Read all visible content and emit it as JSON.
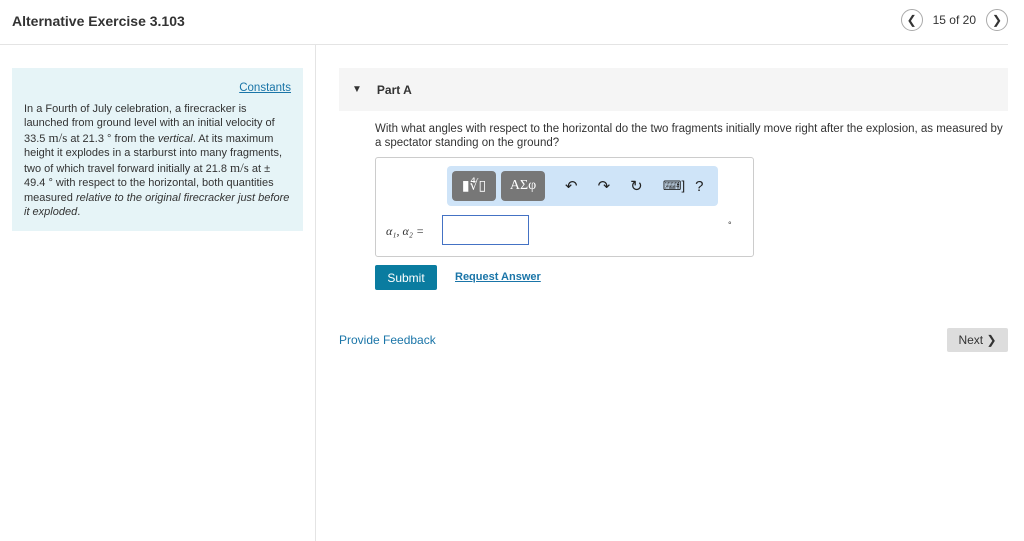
{
  "header": {
    "title": "Alternative Exercise 3.103",
    "position": "15 of 20"
  },
  "problem": {
    "constants_link": "Constants",
    "t1": "In a Fourth of July celebration, a firecracker is launched from ground level with an initial velocity of 33.5 ",
    "u1": "m/s",
    "t2": " at 21.3 ° from the ",
    "em1": "vertical",
    "t3": ". At its maximum height it explodes in a starburst into many fragments, two of which travel forward initially at 21.8 ",
    "u2": "m/s",
    "t4": " at ± 49.4 ° with respect to the horizontal, both quantities measured ",
    "em2": "relative to the original firecracker just before it exploded",
    "t5": "."
  },
  "part": {
    "label": "Part A",
    "question": "With what angles with respect to the horizontal do the two fragments initially move right after the explosion, as measured by a spectator standing on the ground?",
    "toolbar": {
      "templates": "▮∜▯",
      "symbols": "ΑΣφ",
      "undo": "↶",
      "redo": "↷",
      "reset": "↻",
      "keyboard": "⌨]",
      "help": "?"
    },
    "answer_label": "α₁, α₂ =",
    "answer_value": "",
    "unit": "°",
    "submit": "Submit",
    "request": "Request Answer"
  },
  "footer": {
    "feedback": "Provide Feedback",
    "next": "Next ❯"
  }
}
